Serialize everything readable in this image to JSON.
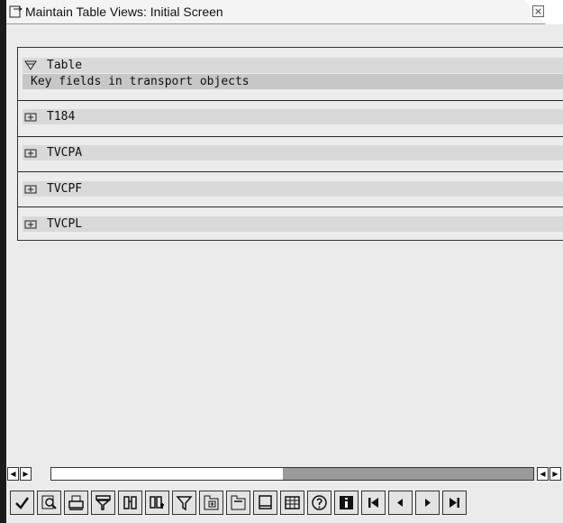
{
  "window": {
    "title": "Maintain Table Views: Initial Screen",
    "close_glyph": "×"
  },
  "tree": {
    "header": {
      "label": "Table",
      "icon": "expanded-folder-icon"
    },
    "subheader": "Key fields in transport objects",
    "items": [
      {
        "label": "T184",
        "icon": "collapsed-node-icon"
      },
      {
        "label": "TVCPA",
        "icon": "collapsed-node-icon"
      },
      {
        "label": "TVCPF",
        "icon": "collapsed-node-icon"
      },
      {
        "label": "TVCPL",
        "icon": "collapsed-node-icon"
      }
    ]
  },
  "scrollbar": {
    "left_glyph": "◀",
    "right_glyph": "▶"
  },
  "toolbar": {
    "buttons": [
      "checkmark-icon",
      "find-icon",
      "print-icon",
      "filter-icon",
      "find-next-icon",
      "find-replace-icon",
      "funnel-icon",
      "expand-subtree-icon",
      "collapse-subtree-icon",
      "page-icon",
      "table-icon",
      "help-icon",
      "info-icon",
      "first-page-icon",
      "previous-page-icon",
      "next-page-icon",
      "last-page-icon"
    ]
  },
  "colors": {
    "band": "#d9d9d9",
    "background": "#ebebeb",
    "frame": "#1b1b1b"
  }
}
